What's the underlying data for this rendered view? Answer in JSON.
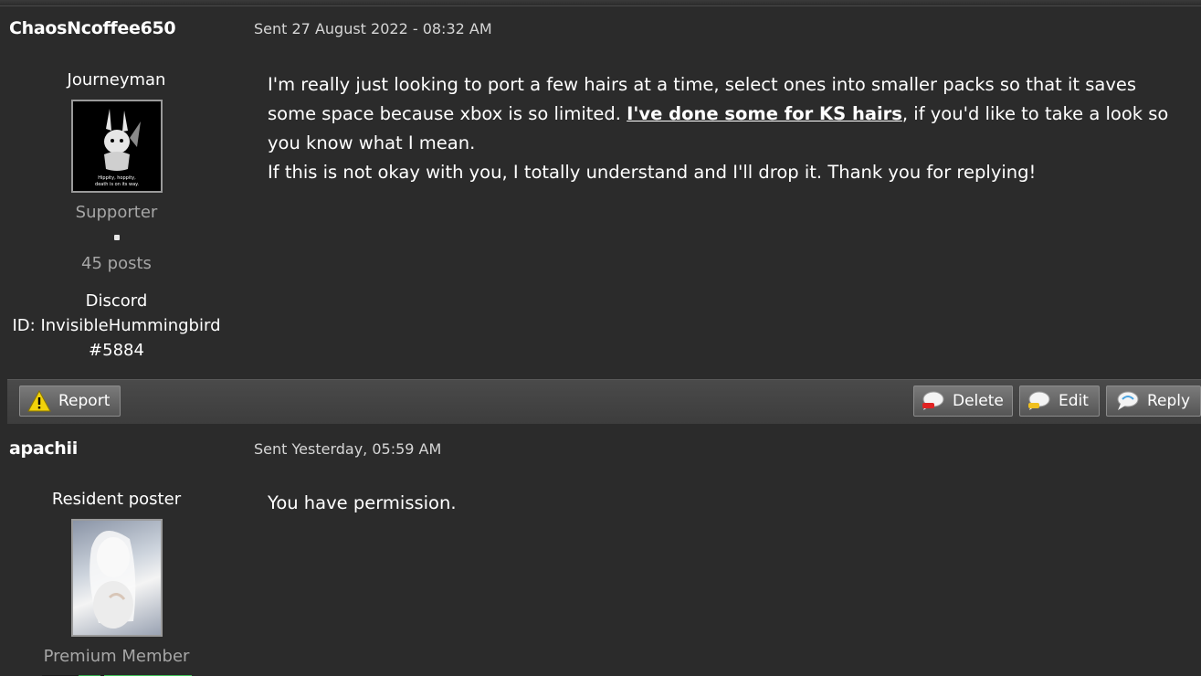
{
  "posts": [
    {
      "author": "ChaosNcoffee650",
      "sent": "Sent 27 August 2022 - 08:32 AM",
      "rank": "Journeyman",
      "avatar_caption": "Hippity, hoppity, death is on its way.",
      "group": "Supporter",
      "post_count": "45 posts",
      "custom_field": [
        "Discord",
        "ID: InvisibleHummingbird",
        "#5884"
      ],
      "body": {
        "line1_pre": "I'm really just looking to port a few hairs at a time, select ones into smaller packs so that it saves some space because xbox is so limited. ",
        "link_text": "I've done some for KS hairs",
        "line1_post": ", if you'd like to take a look so you know what I mean.",
        "line2": "If this is not okay with you, I totally understand and I'll drop it. Thank you for replying!"
      }
    },
    {
      "author": "apachii",
      "sent": "Sent Yesterday, 05:59 AM",
      "rank": "Resident poster",
      "group": "Premium Member",
      "body": {
        "line1": "You have permission."
      }
    }
  ],
  "actions": {
    "report": "Report",
    "delete": "Delete",
    "edit": "Edit",
    "reply": "Reply"
  },
  "icons": {
    "report": "warning-triangle-icon",
    "delete": "speech-bubble-red-icon",
    "edit": "speech-bubble-yellow-icon",
    "reply": "speech-bubble-blue-icon"
  }
}
